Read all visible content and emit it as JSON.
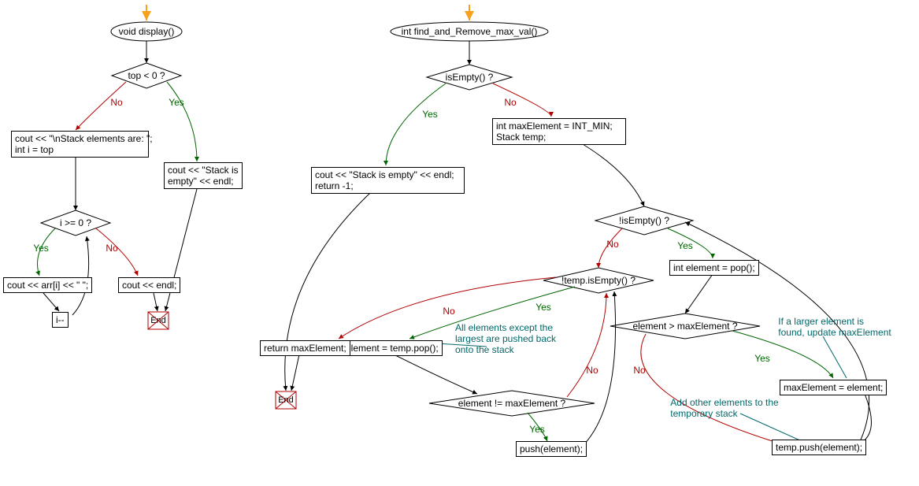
{
  "colors": {
    "yes": "#006400",
    "no": "#b20000",
    "arrow_entry": "#f9a11b"
  },
  "left": {
    "start_label": "void display()",
    "cond_top": "top < 0 ?",
    "yes": "Yes",
    "no": "No",
    "box_empty": "cout << \"Stack is\nempty\" << endl;",
    "box_header": "cout << \"\\nStack elements are: \";\nint i = top",
    "cond_i": "i >= 0 ?",
    "box_print": "cout << arr[i] << \" \";",
    "box_dec": "i--",
    "box_endl": "cout << endl;",
    "end": "End"
  },
  "right": {
    "start_label": "int find_and_Remove_max_val()",
    "cond_empty": "isEmpty() ?",
    "yes": "Yes",
    "no": "No",
    "box_empty_branch": "cout << \"Stack is empty\" << endl;\nreturn -1;",
    "box_init": "int maxElement = INT_MIN;\nStack temp;",
    "cond_loop1": "!isEmpty() ?",
    "box_pop": "int element = pop();",
    "cond_gt": "element > maxElement ?",
    "note_gt": "If a larger element is\nfound, update maxElement",
    "box_setmax": "maxElement = element;",
    "note_add": "Add other elements to the\ntemporary stack",
    "box_temppush": "temp.push(element);",
    "cond_loop2": "!temp.isEmpty() ?",
    "box_tpop": "int element = temp.pop();",
    "note_pushback": "All elements except the\nlargest are pushed back\nonto the stack",
    "cond_neq": "element != maxElement ?",
    "box_push": "push(element);",
    "box_return": "return maxElement;",
    "end": "End"
  },
  "chart_data": {
    "type": "flowchart",
    "flowcharts": [
      {
        "name": "display",
        "nodes": [
          {
            "id": "d_start",
            "type": "start",
            "label": "void display()"
          },
          {
            "id": "d_cond1",
            "type": "decision",
            "label": "top < 0 ?"
          },
          {
            "id": "d_empty",
            "type": "process",
            "label": "cout << \"Stack is empty\" << endl;"
          },
          {
            "id": "d_header",
            "type": "process",
            "label": "cout << \"\\nStack elements are: \"; int i = top"
          },
          {
            "id": "d_cond2",
            "type": "decision",
            "label": "i >= 0 ?"
          },
          {
            "id": "d_print",
            "type": "process",
            "label": "cout << arr[i] << \" \";"
          },
          {
            "id": "d_dec",
            "type": "process",
            "label": "i--"
          },
          {
            "id": "d_endl",
            "type": "process",
            "label": "cout << endl;"
          },
          {
            "id": "d_end1",
            "type": "end",
            "label": "End"
          },
          {
            "id": "d_end2",
            "type": "end",
            "label": "End"
          }
        ],
        "edges": [
          {
            "from": "d_start",
            "to": "d_cond1"
          },
          {
            "from": "d_cond1",
            "to": "d_empty",
            "label": "Yes"
          },
          {
            "from": "d_cond1",
            "to": "d_header",
            "label": "No"
          },
          {
            "from": "d_empty",
            "to": "d_end1"
          },
          {
            "from": "d_header",
            "to": "d_cond2"
          },
          {
            "from": "d_cond2",
            "to": "d_print",
            "label": "Yes"
          },
          {
            "from": "d_print",
            "to": "d_dec"
          },
          {
            "from": "d_dec",
            "to": "d_cond2"
          },
          {
            "from": "d_cond2",
            "to": "d_endl",
            "label": "No"
          },
          {
            "from": "d_endl",
            "to": "d_end2"
          }
        ]
      },
      {
        "name": "find_and_Remove_max_val",
        "nodes": [
          {
            "id": "r_start",
            "type": "start",
            "label": "int find_and_Remove_max_val()"
          },
          {
            "id": "r_cond1",
            "type": "decision",
            "label": "isEmpty() ?"
          },
          {
            "id": "r_emptybranch",
            "type": "process",
            "label": "cout << \"Stack is empty\" << endl; return -1;"
          },
          {
            "id": "r_init",
            "type": "process",
            "label": "int maxElement = INT_MIN; Stack temp;"
          },
          {
            "id": "r_loop1",
            "type": "decision",
            "label": "!isEmpty() ?"
          },
          {
            "id": "r_pop",
            "type": "process",
            "label": "int element = pop();"
          },
          {
            "id": "r_gt",
            "type": "decision",
            "label": "element > maxElement ?"
          },
          {
            "id": "r_setmax",
            "type": "process",
            "label": "maxElement = element;",
            "note": "If a larger element is found, update maxElement"
          },
          {
            "id": "r_temppush",
            "type": "process",
            "label": "temp.push(element);",
            "note": "Add other elements to the temporary stack"
          },
          {
            "id": "r_loop2",
            "type": "decision",
            "label": "!temp.isEmpty() ?"
          },
          {
            "id": "r_tpop",
            "type": "process",
            "label": "int element = temp.pop();",
            "note": "All elements except the largest are pushed back onto the stack"
          },
          {
            "id": "r_neq",
            "type": "decision",
            "label": "element != maxElement ?"
          },
          {
            "id": "r_push",
            "type": "process",
            "label": "push(element);"
          },
          {
            "id": "r_return",
            "type": "process",
            "label": "return maxElement;"
          },
          {
            "id": "r_end",
            "type": "end",
            "label": "End"
          }
        ],
        "edges": [
          {
            "from": "r_start",
            "to": "r_cond1"
          },
          {
            "from": "r_cond1",
            "to": "r_emptybranch",
            "label": "Yes"
          },
          {
            "from": "r_cond1",
            "to": "r_init",
            "label": "No"
          },
          {
            "from": "r_emptybranch",
            "to": "r_end"
          },
          {
            "from": "r_init",
            "to": "r_loop1"
          },
          {
            "from": "r_loop1",
            "to": "r_pop",
            "label": "Yes"
          },
          {
            "from": "r_pop",
            "to": "r_gt"
          },
          {
            "from": "r_gt",
            "to": "r_setmax",
            "label": "Yes"
          },
          {
            "from": "r_setmax",
            "to": "r_temppush"
          },
          {
            "from": "r_gt",
            "to": "r_temppush",
            "label": "No"
          },
          {
            "from": "r_temppush",
            "to": "r_loop1"
          },
          {
            "from": "r_loop1",
            "to": "r_loop2",
            "label": "No"
          },
          {
            "from": "r_loop2",
            "to": "r_tpop",
            "label": "Yes"
          },
          {
            "from": "r_tpop",
            "to": "r_neq"
          },
          {
            "from": "r_neq",
            "to": "r_push",
            "label": "Yes"
          },
          {
            "from": "r_push",
            "to": "r_loop2"
          },
          {
            "from": "r_neq",
            "to": "r_loop2",
            "label": "No"
          },
          {
            "from": "r_loop2",
            "to": "r_return",
            "label": "No"
          },
          {
            "from": "r_return",
            "to": "r_end"
          }
        ]
      }
    ]
  }
}
